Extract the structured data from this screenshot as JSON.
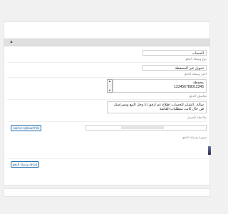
{
  "panel": {
    "toggle_icon": "triangle-up-icon"
  },
  "fields": {
    "account_label_label": "الحساب",
    "account_type_hint": "نوع وسيلة الدفع",
    "method_value": "تحويل غير المحفظة",
    "method_hint": "اختر وسيلة الدفع",
    "wallet_value_line1": "محفظة",
    "wallet_value_line2": "123456789012345",
    "wallet_hint": "تفاصيل الدفع",
    "description_value": "سالة...الشكر للحساب اطلاع عم ارفق انا وجل البيع وبسراسك في حال كانت متطلبات القائمة",
    "description_hint": "ملاحظة للعميل"
  },
  "file": {
    "upload_button": "Add or Upload File",
    "hint": "صورة وسيلة الدفع"
  },
  "actions": {
    "add_payment_button": "إضافة وسيلة الدفع"
  }
}
